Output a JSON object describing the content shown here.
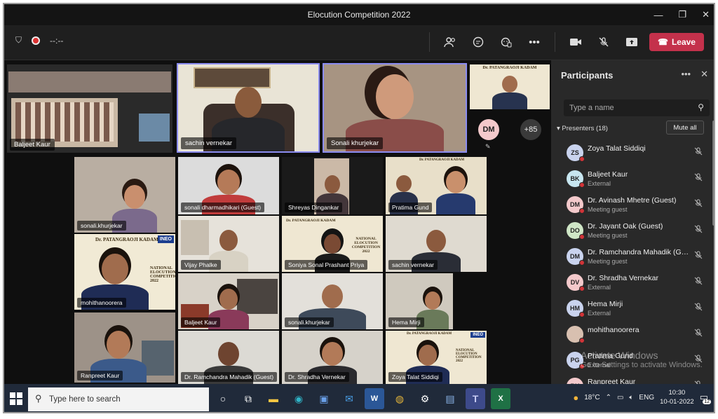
{
  "window": {
    "title": "Elocution Competition 2022"
  },
  "toolbar": {
    "timer": "--:--",
    "leave_label": "Leave"
  },
  "stage": {
    "top_tiles": [
      {
        "name": "Baljeet Kaur"
      },
      {
        "name": "sachin vernekar"
      },
      {
        "name": "Sonali khurjekar"
      }
    ],
    "overflow_initials": "DM",
    "overflow_count": "+85",
    "grid_tiles": [
      "sonali.khurjekar",
      "sonali dharmadhikari (Guest)",
      "Shreyas Dingankar",
      "Pratima Gund",
      "Vijay Phalke",
      "Soniya Sonal Prashant Priya",
      "sachin vernekar",
      "mohithanoorera",
      "Baljeet Kaur",
      "sonali.khurjekar",
      "Hema Mirji",
      "Ranpreet Kaur",
      "Dr. Ramchandra Mahadik (Guest)",
      "Dr. Shradha Vernekar",
      "Zoya Talat Siddiqi"
    ],
    "banner_small_title": "Dr. PATANGRAOJI KADAM",
    "banner_title": "Dr. PATANGRAOJI KADAM",
    "banner_logo": "INEO",
    "banner_text": "NATIONAL ELOCUTION COMPETITION 2022",
    "banner_text_short": "NATIONAL ELOCUTION COMPETITION 2022"
  },
  "participants": {
    "title": "Participants",
    "search_placeholder": "Type a name",
    "presenters_label": "Presenters (18)",
    "mute_all_label": "Mute all",
    "list": [
      {
        "initials": "ZS",
        "name": "Zoya Talat Siddiqi",
        "sub": "",
        "color": "#c9d3ee"
      },
      {
        "initials": "BK",
        "name": "Baljeet Kaur",
        "sub": "External",
        "color": "#c7e6f0"
      },
      {
        "initials": "DM",
        "name": "Dr. Avinash Mhetre (Guest)",
        "sub": "Meeting guest",
        "color": "#f3c9cb"
      },
      {
        "initials": "DO",
        "name": "Dr. Jayant Oak (Guest)",
        "sub": "Meeting guest",
        "color": "#cfe6c6"
      },
      {
        "initials": "DM",
        "name": "Dr. Ramchandra Mahadik (Gu...",
        "sub": "Meeting guest",
        "color": "#c9d3ee"
      },
      {
        "initials": "DV",
        "name": "Dr. Shradha Vernekar",
        "sub": "External",
        "color": "#f3c9cb"
      },
      {
        "initials": "HM",
        "name": "Hema Mirji",
        "sub": "External",
        "color": "#c9d3ee"
      },
      {
        "initials": "",
        "name": "mohithanoorera",
        "sub": "",
        "color": "#d8c0b0"
      },
      {
        "initials": "PG",
        "name": "Pratima Gund",
        "sub": "External",
        "color": "#c9d3ee"
      },
      {
        "initials": "RK",
        "name": "Ranpreet Kaur",
        "sub": "",
        "color": "#f3c9cb"
      }
    ],
    "watermark_line1": "Activate Windows",
    "watermark_line2": "Go to Settings to activate Windows."
  },
  "taskbar": {
    "search_placeholder": "Type here to search",
    "temperature": "18°C",
    "language": "ENG",
    "time": "10:30",
    "date": "10-01-2022",
    "notifications": "12"
  }
}
